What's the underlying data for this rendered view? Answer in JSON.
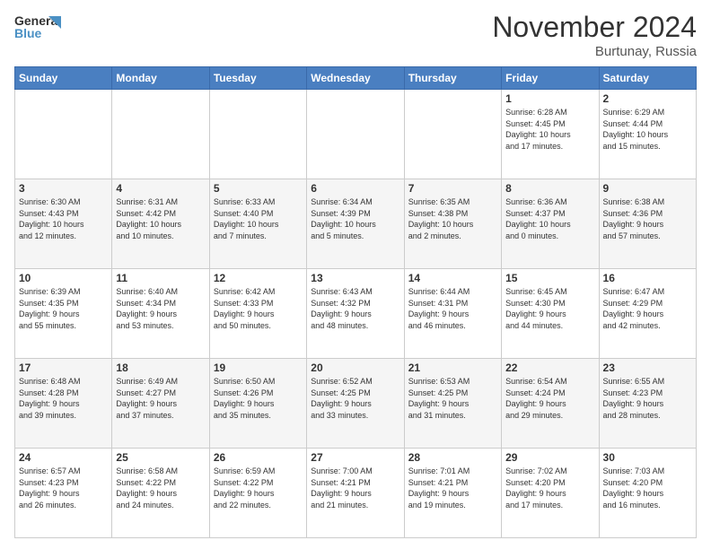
{
  "header": {
    "title": "November 2024",
    "location": "Burtunay, Russia"
  },
  "calendar": {
    "headers": [
      "Sunday",
      "Monday",
      "Tuesday",
      "Wednesday",
      "Thursday",
      "Friday",
      "Saturday"
    ],
    "rows": [
      [
        {
          "day": "",
          "info": ""
        },
        {
          "day": "",
          "info": ""
        },
        {
          "day": "",
          "info": ""
        },
        {
          "day": "",
          "info": ""
        },
        {
          "day": "",
          "info": ""
        },
        {
          "day": "1",
          "info": "Sunrise: 6:28 AM\nSunset: 4:45 PM\nDaylight: 10 hours\nand 17 minutes."
        },
        {
          "day": "2",
          "info": "Sunrise: 6:29 AM\nSunset: 4:44 PM\nDaylight: 10 hours\nand 15 minutes."
        }
      ],
      [
        {
          "day": "3",
          "info": "Sunrise: 6:30 AM\nSunset: 4:43 PM\nDaylight: 10 hours\nand 12 minutes."
        },
        {
          "day": "4",
          "info": "Sunrise: 6:31 AM\nSunset: 4:42 PM\nDaylight: 10 hours\nand 10 minutes."
        },
        {
          "day": "5",
          "info": "Sunrise: 6:33 AM\nSunset: 4:40 PM\nDaylight: 10 hours\nand 7 minutes."
        },
        {
          "day": "6",
          "info": "Sunrise: 6:34 AM\nSunset: 4:39 PM\nDaylight: 10 hours\nand 5 minutes."
        },
        {
          "day": "7",
          "info": "Sunrise: 6:35 AM\nSunset: 4:38 PM\nDaylight: 10 hours\nand 2 minutes."
        },
        {
          "day": "8",
          "info": "Sunrise: 6:36 AM\nSunset: 4:37 PM\nDaylight: 10 hours\nand 0 minutes."
        },
        {
          "day": "9",
          "info": "Sunrise: 6:38 AM\nSunset: 4:36 PM\nDaylight: 9 hours\nand 57 minutes."
        }
      ],
      [
        {
          "day": "10",
          "info": "Sunrise: 6:39 AM\nSunset: 4:35 PM\nDaylight: 9 hours\nand 55 minutes."
        },
        {
          "day": "11",
          "info": "Sunrise: 6:40 AM\nSunset: 4:34 PM\nDaylight: 9 hours\nand 53 minutes."
        },
        {
          "day": "12",
          "info": "Sunrise: 6:42 AM\nSunset: 4:33 PM\nDaylight: 9 hours\nand 50 minutes."
        },
        {
          "day": "13",
          "info": "Sunrise: 6:43 AM\nSunset: 4:32 PM\nDaylight: 9 hours\nand 48 minutes."
        },
        {
          "day": "14",
          "info": "Sunrise: 6:44 AM\nSunset: 4:31 PM\nDaylight: 9 hours\nand 46 minutes."
        },
        {
          "day": "15",
          "info": "Sunrise: 6:45 AM\nSunset: 4:30 PM\nDaylight: 9 hours\nand 44 minutes."
        },
        {
          "day": "16",
          "info": "Sunrise: 6:47 AM\nSunset: 4:29 PM\nDaylight: 9 hours\nand 42 minutes."
        }
      ],
      [
        {
          "day": "17",
          "info": "Sunrise: 6:48 AM\nSunset: 4:28 PM\nDaylight: 9 hours\nand 39 minutes."
        },
        {
          "day": "18",
          "info": "Sunrise: 6:49 AM\nSunset: 4:27 PM\nDaylight: 9 hours\nand 37 minutes."
        },
        {
          "day": "19",
          "info": "Sunrise: 6:50 AM\nSunset: 4:26 PM\nDaylight: 9 hours\nand 35 minutes."
        },
        {
          "day": "20",
          "info": "Sunrise: 6:52 AM\nSunset: 4:25 PM\nDaylight: 9 hours\nand 33 minutes."
        },
        {
          "day": "21",
          "info": "Sunrise: 6:53 AM\nSunset: 4:25 PM\nDaylight: 9 hours\nand 31 minutes."
        },
        {
          "day": "22",
          "info": "Sunrise: 6:54 AM\nSunset: 4:24 PM\nDaylight: 9 hours\nand 29 minutes."
        },
        {
          "day": "23",
          "info": "Sunrise: 6:55 AM\nSunset: 4:23 PM\nDaylight: 9 hours\nand 28 minutes."
        }
      ],
      [
        {
          "day": "24",
          "info": "Sunrise: 6:57 AM\nSunset: 4:23 PM\nDaylight: 9 hours\nand 26 minutes."
        },
        {
          "day": "25",
          "info": "Sunrise: 6:58 AM\nSunset: 4:22 PM\nDaylight: 9 hours\nand 24 minutes."
        },
        {
          "day": "26",
          "info": "Sunrise: 6:59 AM\nSunset: 4:22 PM\nDaylight: 9 hours\nand 22 minutes."
        },
        {
          "day": "27",
          "info": "Sunrise: 7:00 AM\nSunset: 4:21 PM\nDaylight: 9 hours\nand 21 minutes."
        },
        {
          "day": "28",
          "info": "Sunrise: 7:01 AM\nSunset: 4:21 PM\nDaylight: 9 hours\nand 19 minutes."
        },
        {
          "day": "29",
          "info": "Sunrise: 7:02 AM\nSunset: 4:20 PM\nDaylight: 9 hours\nand 17 minutes."
        },
        {
          "day": "30",
          "info": "Sunrise: 7:03 AM\nSunset: 4:20 PM\nDaylight: 9 hours\nand 16 minutes."
        }
      ]
    ]
  }
}
